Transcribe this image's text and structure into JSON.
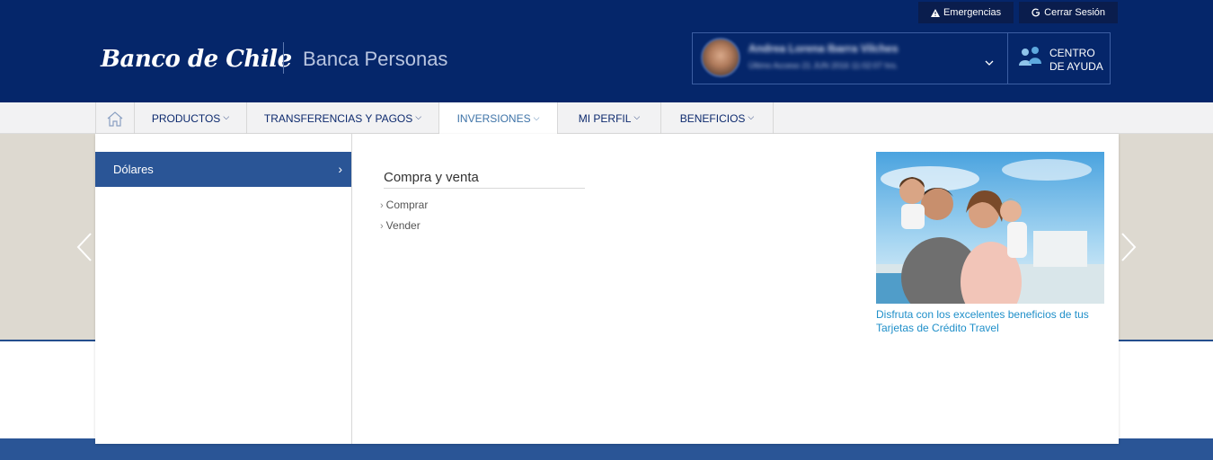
{
  "utility": {
    "emergencies_label": "Emergencias",
    "logout_label": "Cerrar Sesión"
  },
  "brand": {
    "logo_text": "Banco de Chile",
    "subbrand": "Banca Personas"
  },
  "user": {
    "name": "Andrea Lorena Ibarra Vilches",
    "last_access": "Último Acceso 21 JUN 2016 11:02:07 hrs."
  },
  "help": {
    "line1": "CENTRO",
    "line2": "DE AYUDA"
  },
  "nav": {
    "items": [
      {
        "label": "PRODUCTOS"
      },
      {
        "label": "TRANSFERENCIAS Y PAGOS"
      },
      {
        "label": "INVERSIONES"
      },
      {
        "label": "MI PERFIL"
      },
      {
        "label": "BENEFICIOS"
      }
    ],
    "active": "INVERSIONES"
  },
  "menu": {
    "submenu": [
      {
        "label": "Dólares"
      }
    ],
    "group_title": "Compra y venta",
    "links": [
      {
        "label": "Comprar"
      },
      {
        "label": "Vender"
      }
    ],
    "promo_text": "Disfruta con los excelentes beneficios de tus Tarjetas de Crédito Travel"
  },
  "colors": {
    "header_bg": "#05266a",
    "accent": "#2a5596",
    "link": "#1f8fc9"
  },
  "icons": [
    "warning-icon",
    "logout-icon",
    "chevron-down-icon",
    "help-people-icon",
    "home-icon",
    "chevron-right-icon",
    "arrow-left-icon",
    "arrow-right-icon"
  ]
}
